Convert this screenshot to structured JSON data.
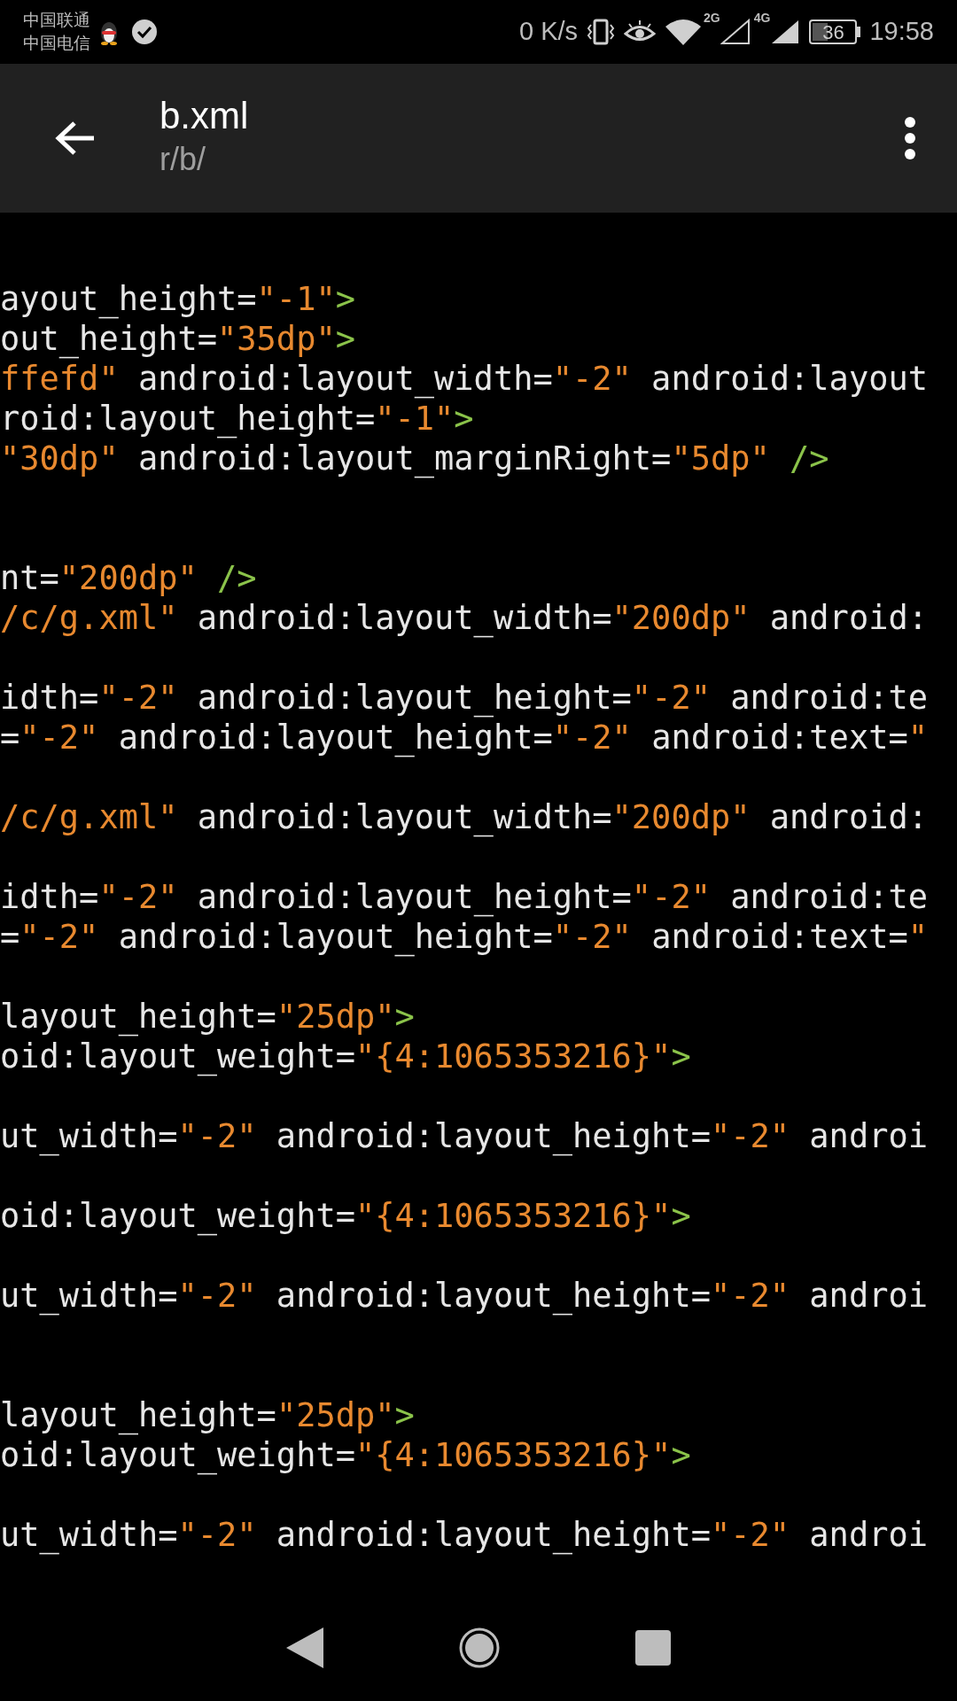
{
  "status_bar": {
    "carriers": [
      "中国联通",
      "中国电信"
    ],
    "speed": "0 K/s",
    "network_1": "2G",
    "network_2": "4G",
    "battery": "36",
    "time": "19:58"
  },
  "app_bar": {
    "title": "b.xml",
    "subtitle": "r/b/"
  },
  "code_lines": [
    {
      "kind": "code",
      "parts": [
        {
          "kind": "attr",
          "text": "ayout_height="
        },
        {
          "kind": "string",
          "text": "\"-1\""
        },
        {
          "kind": "tag",
          "text": ">"
        }
      ]
    },
    {
      "kind": "code",
      "parts": [
        {
          "kind": "attr",
          "text": "out_height="
        },
        {
          "kind": "string",
          "text": "\"35dp\""
        },
        {
          "kind": "tag",
          "text": ">"
        }
      ]
    },
    {
      "kind": "code",
      "parts": [
        {
          "kind": "string",
          "text": "ffefd\""
        },
        {
          "kind": "attr",
          "text": " android:layout_width="
        },
        {
          "kind": "string",
          "text": "\"-2\""
        },
        {
          "kind": "attr",
          "text": " android:layout"
        }
      ]
    },
    {
      "kind": "code",
      "parts": [
        {
          "kind": "attr",
          "text": "roid:layout_height="
        },
        {
          "kind": "string",
          "text": "\"-1\""
        },
        {
          "kind": "tag",
          "text": ">"
        }
      ]
    },
    {
      "kind": "code",
      "parts": [
        {
          "kind": "string",
          "text": "\"30dp\""
        },
        {
          "kind": "attr",
          "text": " android:layout_marginRight="
        },
        {
          "kind": "string",
          "text": "\"5dp\""
        },
        {
          "kind": "tag",
          "text": " />"
        }
      ]
    },
    {
      "kind": "blank"
    },
    {
      "kind": "blank"
    },
    {
      "kind": "code",
      "parts": [
        {
          "kind": "attr",
          "text": "nt="
        },
        {
          "kind": "string",
          "text": "\"200dp\""
        },
        {
          "kind": "tag",
          "text": " />"
        }
      ]
    },
    {
      "kind": "code",
      "parts": [
        {
          "kind": "string",
          "text": "/c/g.xml\""
        },
        {
          "kind": "attr",
          "text": " android:layout_width="
        },
        {
          "kind": "string",
          "text": "\"200dp\""
        },
        {
          "kind": "attr",
          "text": " android:"
        }
      ]
    },
    {
      "kind": "blank"
    },
    {
      "kind": "code",
      "parts": [
        {
          "kind": "attr",
          "text": "idth="
        },
        {
          "kind": "string",
          "text": "\"-2\""
        },
        {
          "kind": "attr",
          "text": " android:layout_height="
        },
        {
          "kind": "string",
          "text": "\"-2\""
        },
        {
          "kind": "attr",
          "text": " android:te"
        }
      ]
    },
    {
      "kind": "code",
      "parts": [
        {
          "kind": "attr",
          "text": "="
        },
        {
          "kind": "string",
          "text": "\"-2\""
        },
        {
          "kind": "attr",
          "text": " android:layout_height="
        },
        {
          "kind": "string",
          "text": "\"-2\""
        },
        {
          "kind": "attr",
          "text": " android:text="
        },
        {
          "kind": "string",
          "text": "\""
        }
      ]
    },
    {
      "kind": "blank"
    },
    {
      "kind": "code",
      "parts": [
        {
          "kind": "string",
          "text": "/c/g.xml\""
        },
        {
          "kind": "attr",
          "text": " android:layout_width="
        },
        {
          "kind": "string",
          "text": "\"200dp\""
        },
        {
          "kind": "attr",
          "text": " android:"
        }
      ]
    },
    {
      "kind": "blank"
    },
    {
      "kind": "code",
      "parts": [
        {
          "kind": "attr",
          "text": "idth="
        },
        {
          "kind": "string",
          "text": "\"-2\""
        },
        {
          "kind": "attr",
          "text": " android:layout_height="
        },
        {
          "kind": "string",
          "text": "\"-2\""
        },
        {
          "kind": "attr",
          "text": " android:te"
        }
      ]
    },
    {
      "kind": "code",
      "parts": [
        {
          "kind": "attr",
          "text": "="
        },
        {
          "kind": "string",
          "text": "\"-2\""
        },
        {
          "kind": "attr",
          "text": " android:layout_height="
        },
        {
          "kind": "string",
          "text": "\"-2\""
        },
        {
          "kind": "attr",
          "text": " android:text="
        },
        {
          "kind": "string",
          "text": "\""
        }
      ]
    },
    {
      "kind": "blank"
    },
    {
      "kind": "code",
      "parts": [
        {
          "kind": "attr",
          "text": "layout_height="
        },
        {
          "kind": "string",
          "text": "\"25dp\""
        },
        {
          "kind": "tag",
          "text": ">"
        }
      ]
    },
    {
      "kind": "code",
      "parts": [
        {
          "kind": "attr",
          "text": "oid:layout_weight="
        },
        {
          "kind": "string",
          "text": "\"{4:1065353216}\""
        },
        {
          "kind": "tag",
          "text": ">"
        }
      ]
    },
    {
      "kind": "blank"
    },
    {
      "kind": "code",
      "parts": [
        {
          "kind": "attr",
          "text": "ut_width="
        },
        {
          "kind": "string",
          "text": "\"-2\""
        },
        {
          "kind": "attr",
          "text": " android:layout_height="
        },
        {
          "kind": "string",
          "text": "\"-2\""
        },
        {
          "kind": "attr",
          "text": " androi"
        }
      ]
    },
    {
      "kind": "blank"
    },
    {
      "kind": "code",
      "parts": [
        {
          "kind": "attr",
          "text": "oid:layout_weight="
        },
        {
          "kind": "string",
          "text": "\"{4:1065353216}\""
        },
        {
          "kind": "tag",
          "text": ">"
        }
      ]
    },
    {
      "kind": "blank"
    },
    {
      "kind": "code",
      "parts": [
        {
          "kind": "attr",
          "text": "ut_width="
        },
        {
          "kind": "string",
          "text": "\"-2\""
        },
        {
          "kind": "attr",
          "text": " android:layout_height="
        },
        {
          "kind": "string",
          "text": "\"-2\""
        },
        {
          "kind": "attr",
          "text": " androi"
        }
      ]
    },
    {
      "kind": "blank"
    },
    {
      "kind": "blank"
    },
    {
      "kind": "code",
      "parts": [
        {
          "kind": "attr",
          "text": "layout_height="
        },
        {
          "kind": "string",
          "text": "\"25dp\""
        },
        {
          "kind": "tag",
          "text": ">"
        }
      ]
    },
    {
      "kind": "code",
      "parts": [
        {
          "kind": "attr",
          "text": "oid:layout_weight="
        },
        {
          "kind": "string",
          "text": "\"{4:1065353216}\""
        },
        {
          "kind": "tag",
          "text": ">"
        }
      ]
    },
    {
      "kind": "blank"
    },
    {
      "kind": "code",
      "parts": [
        {
          "kind": "attr",
          "text": "ut_width="
        },
        {
          "kind": "string",
          "text": "\"-2\""
        },
        {
          "kind": "attr",
          "text": " android:layout_height="
        },
        {
          "kind": "string",
          "text": "\"-2\""
        },
        {
          "kind": "attr",
          "text": " androi"
        }
      ]
    }
  ]
}
